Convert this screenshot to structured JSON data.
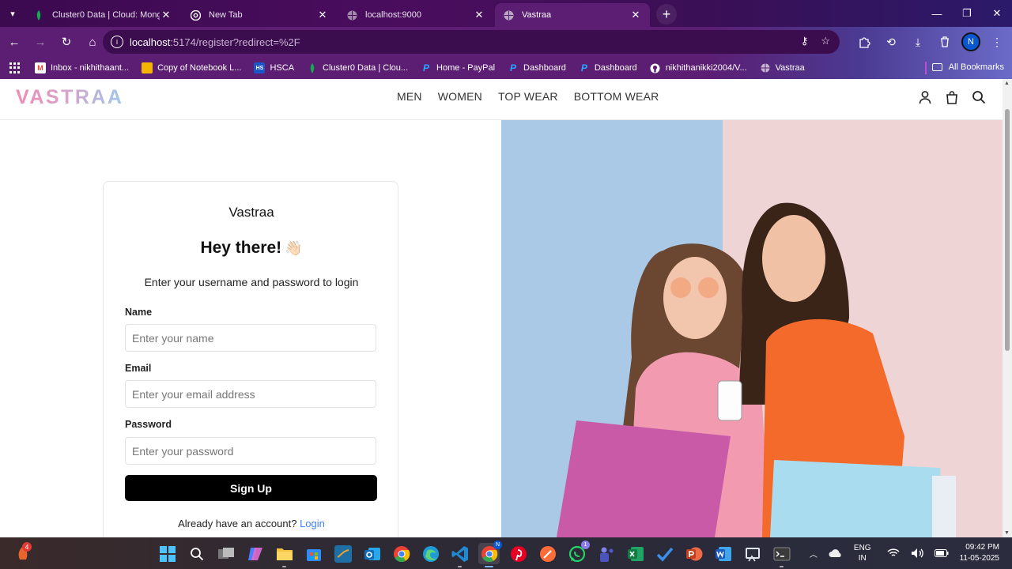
{
  "browser": {
    "tabs": [
      {
        "title": "Cluster0 Data | Cloud: MongoDB",
        "icon": "mongodb-leaf-icon",
        "active": false
      },
      {
        "title": "New Tab",
        "icon": "chrome-icon",
        "active": false
      },
      {
        "title": "localhost:9000",
        "icon": "globe-icon",
        "active": false
      },
      {
        "title": "Vastraa",
        "icon": "globe-icon",
        "active": true
      }
    ],
    "url_host": "localhost",
    "url_path": ":5174/register?redirect=%2F",
    "profile_initial": "N",
    "bookmarks": [
      {
        "label": "Inbox - nikhithaant...",
        "icon": "gmail-icon"
      },
      {
        "label": "Copy of Notebook L...",
        "icon": "slides-icon"
      },
      {
        "label": "HSCA",
        "icon": "hs-icon"
      },
      {
        "label": "Cluster0 Data | Clou...",
        "icon": "mongodb-leaf-icon"
      },
      {
        "label": "Home - PayPal",
        "icon": "paypal-icon"
      },
      {
        "label": "Dashboard",
        "icon": "paypal-icon"
      },
      {
        "label": "Dashboard",
        "icon": "paypal-icon"
      },
      {
        "label": "nikhithanikki2004/V...",
        "icon": "github-icon"
      },
      {
        "label": "Vastraa",
        "icon": "globe-icon"
      }
    ],
    "all_bookmarks": "All Bookmarks"
  },
  "site": {
    "logo": "VASTRAA",
    "nav": [
      "MEN",
      "WOMEN",
      "TOP WEAR",
      "BOTTOM WEAR"
    ]
  },
  "form": {
    "brand": "Vastraa",
    "greeting": "Hey there!",
    "greeting_emoji": "👋🏻",
    "subtitle": "Enter your username and password to login",
    "name_label": "Name",
    "name_placeholder": "Enter your name",
    "email_label": "Email",
    "email_placeholder": "Enter your email address",
    "password_label": "Password",
    "password_placeholder": "Enter your password",
    "submit_label": "Sign Up",
    "login_prompt": "Already have an account?",
    "login_link": "Login"
  },
  "taskbar": {
    "notification_count": "4",
    "whatsapp_badge": "1",
    "language": "ENG",
    "region": "IN",
    "time": "09:42 PM",
    "date": "11-05-2025"
  },
  "colors": {
    "browser_frame": "#5b1e73",
    "logo_gradient_start": "#f08ab2",
    "logo_gradient_end": "#9fc6e8",
    "signup_button": "#000000",
    "login_link": "#3b82f6",
    "hero_left_bg": "#a9c9e6",
    "hero_right_bg": "#efd4d6"
  }
}
